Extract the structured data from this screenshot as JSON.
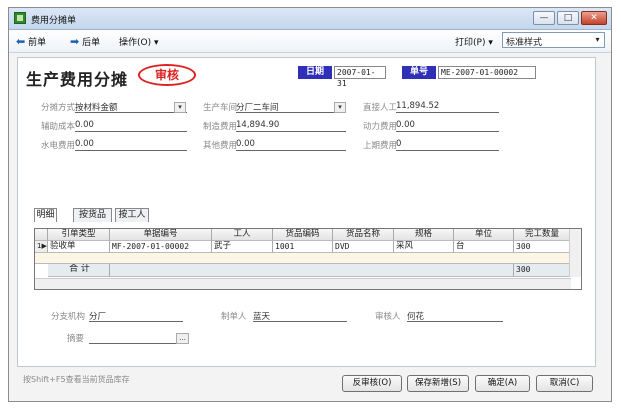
{
  "window": {
    "title": "费用分摊单",
    "minimize": "—",
    "maximize": "□",
    "close": "✕"
  },
  "toolbar": {
    "prev": "前单",
    "next": "后单",
    "ops": "操作(O)",
    "print": "打印(P)",
    "style_value": "标准样式",
    "prev_arrow": "⬅",
    "next_arrow": "➡",
    "caret": "▾"
  },
  "header": {
    "title": "生产费用分摊",
    "stamp": "审核",
    "date_label": "日期",
    "date_value": "2007-01-31",
    "number_label": "单号",
    "number_value": "ME-2007-01-00002"
  },
  "fields": {
    "alloc_method_label": "分摊方式",
    "alloc_method_value": "按材料金额",
    "workshop_label": "生产车间",
    "workshop_value": "分厂二车间",
    "direct_labor_label": "直接人工",
    "direct_labor_value": "11,894.52",
    "aux_cost_label": "辅助成本",
    "aux_cost_value": "0.00",
    "mfg_cost_label": "制造费用",
    "mfg_cost_value": "14,894.90",
    "power_cost_label": "动力费用",
    "power_cost_value": "0.00",
    "utility_label": "水电费用",
    "utility_value": "0.00",
    "other_label": "其他费用",
    "other_value": "0.00",
    "prev_period_label": "上期费用",
    "prev_period_value": "0"
  },
  "tabs": [
    "明细",
    "按货品",
    "按工人"
  ],
  "grid": {
    "headers": [
      "引单类型",
      "单据编号",
      "工人",
      "货品编码",
      "货品名称",
      "规格",
      "单位",
      "完工数量"
    ],
    "rows": [
      {
        "idx": "1",
        "cells": [
          "验收单",
          "MF-2007-01-00002",
          "武子",
          "1001",
          "DVD",
          "采风",
          "台",
          "300"
        ]
      }
    ],
    "total_label": "合 计",
    "total_qty": "300"
  },
  "footer": {
    "branch_label": "分支机构",
    "branch_value": "分厂",
    "maker_label": "制单人",
    "maker_value": "蓝天",
    "auditor_label": "审核人",
    "auditor_value": "何花",
    "summary_label": "摘要",
    "ellipsis": "..."
  },
  "status_text": "按Shift+F5查看当前货品库存",
  "buttons": {
    "unaudit": "反审核(O)",
    "save_new": "保存新增(S)",
    "ok": "确定(A)",
    "cancel": "取消(C)"
  }
}
